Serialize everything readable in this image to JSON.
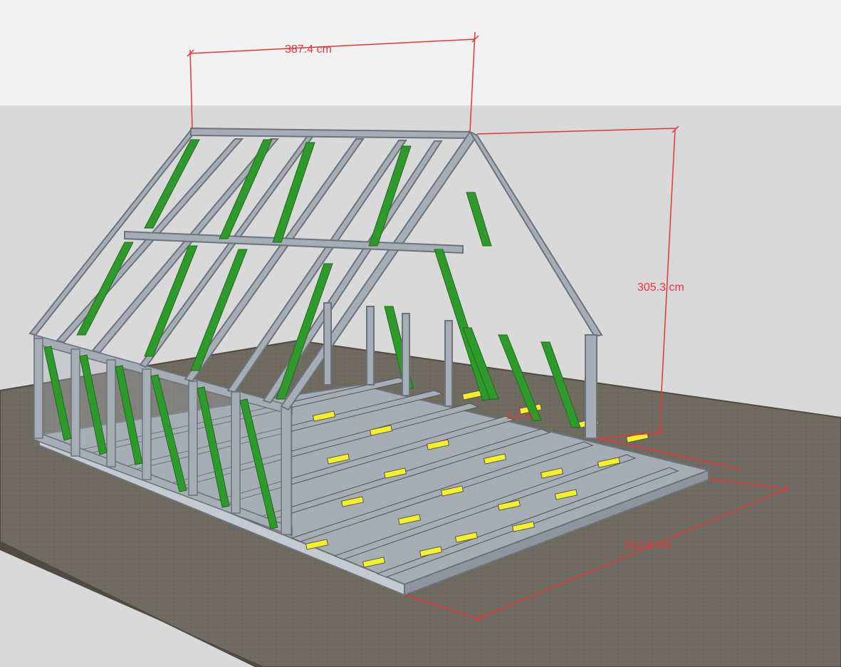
{
  "dimensions": {
    "top_width": "387.4 cm",
    "height": "305.3 cm",
    "depth": "392.0 cm",
    "hidden_width": "1.0 m"
  },
  "colors": {
    "sky": "#f2f2f2",
    "wall_background": "#d9d9d9",
    "ground": "#6e6a60",
    "ground_edge": "#4f4b44",
    "steel": "#a7adb5",
    "steel_dark": "#6d737b",
    "brace_green": "#2f9a2c",
    "joist_yellow": "#f4f02a",
    "dimension_red": "#e8343a"
  }
}
